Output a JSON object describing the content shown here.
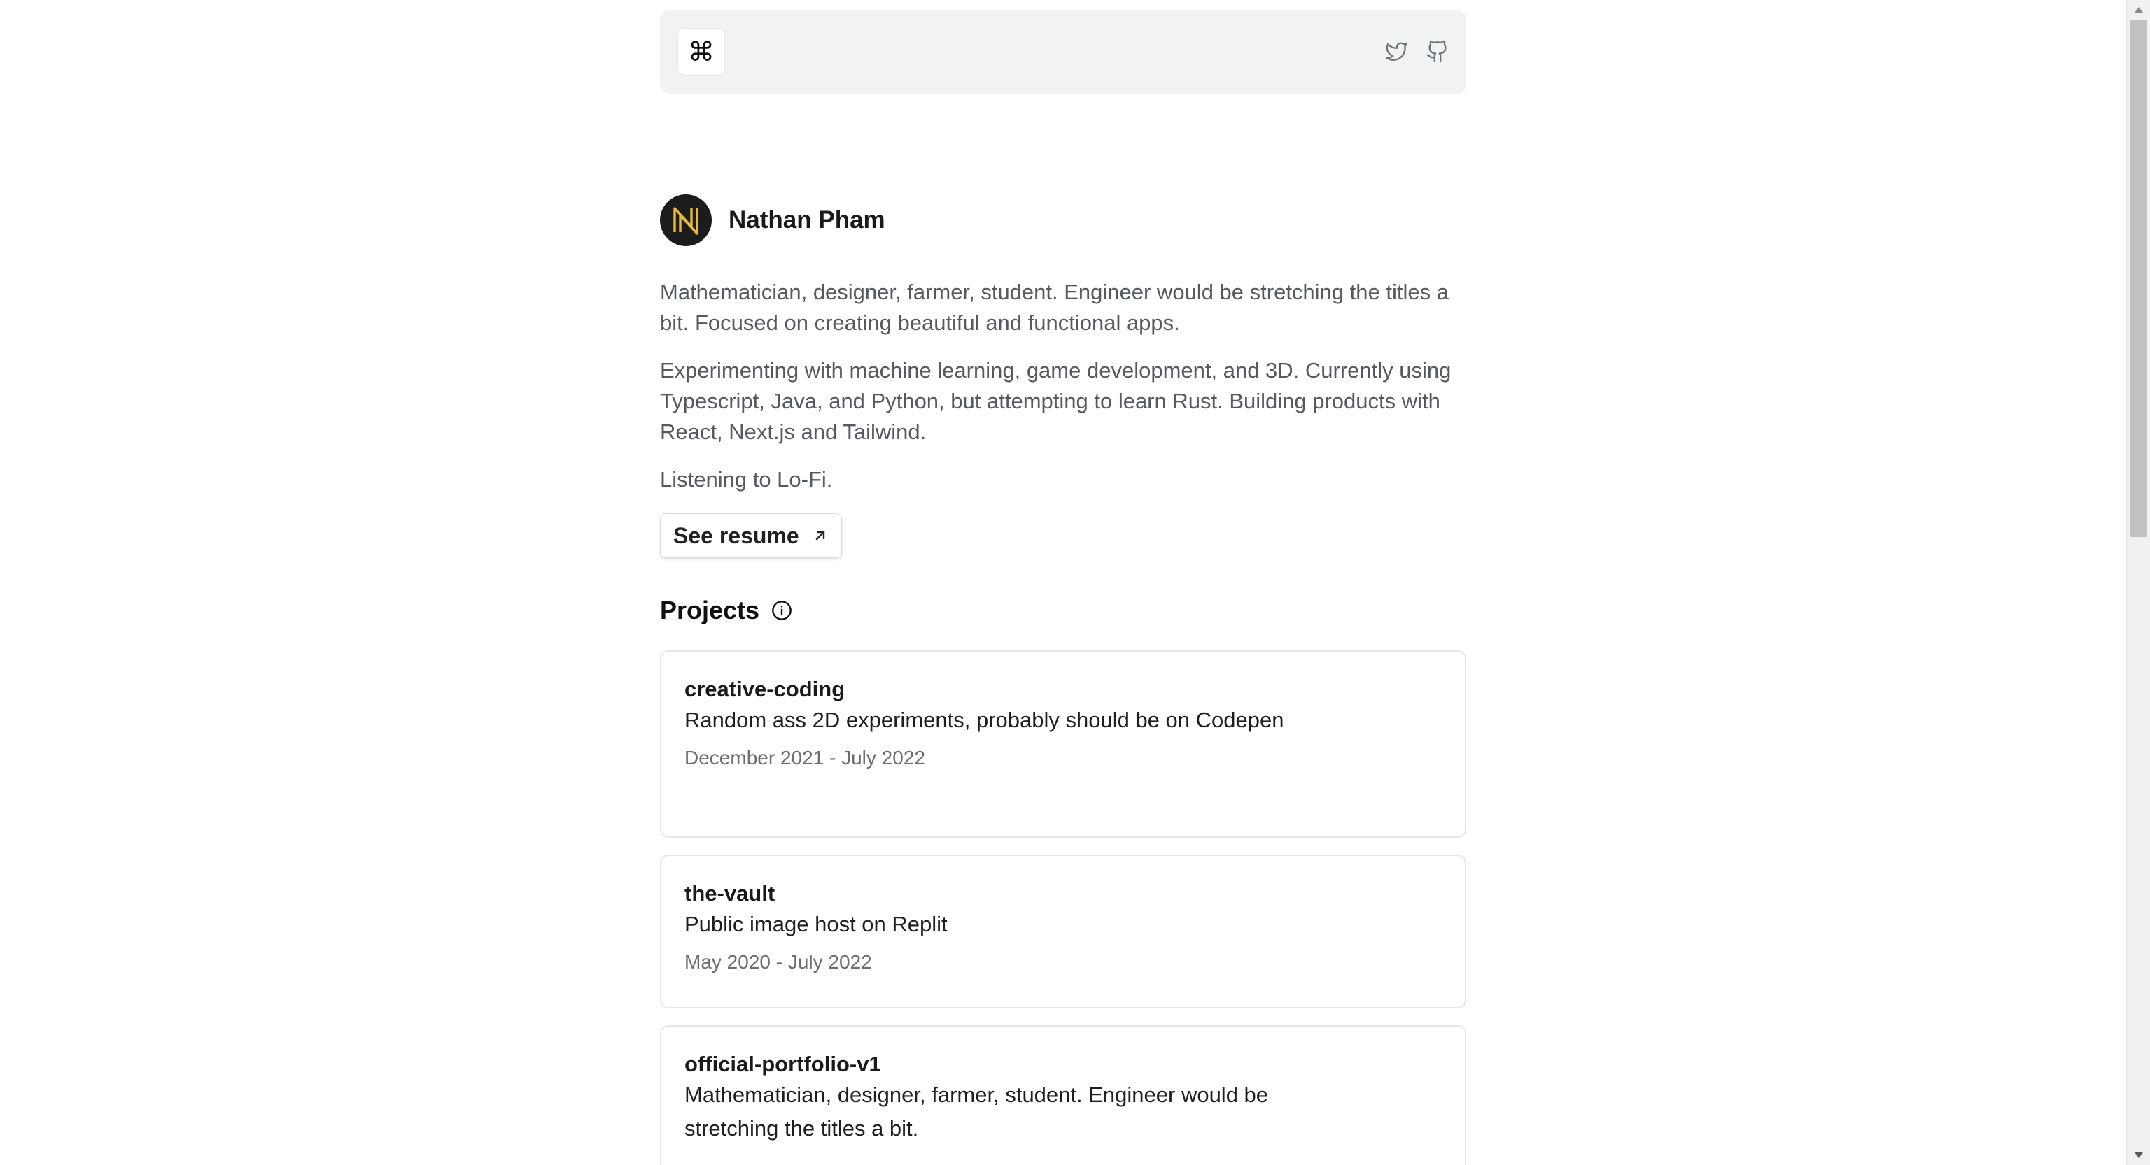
{
  "header": {
    "command_glyph": "⌘",
    "icons": [
      "twitter-icon",
      "github-icon"
    ]
  },
  "profile": {
    "name": "Nathan Pham",
    "avatar_letter": "N",
    "avatar_color": "#e8b93a"
  },
  "bio": {
    "p1": "Mathematician, designer, farmer, student. Engineer would be stretching the titles a bit. Focused on creating beautiful and functional apps.",
    "p2": "Experimenting with machine learning, game development, and 3D. Currently using Typescript, Java, and Python, but attempting to learn Rust. Building products with React, Next.js and Tailwind.",
    "p3": "Listening to Lo-Fi."
  },
  "resume": {
    "label": "See resume"
  },
  "projects": {
    "heading": "Projects",
    "items": [
      {
        "title": "creative-coding",
        "description": "Random ass 2D experiments, probably should be on Codepen",
        "dates": "December 2021 - July 2022"
      },
      {
        "title": "the-vault",
        "description": "Public image host on Replit",
        "dates": "May 2020 - July 2022"
      },
      {
        "title": "official-portfolio-v1",
        "description": "Mathematician, designer, farmer, student. Engineer would be stretching the titles a bit.",
        "dates": ""
      }
    ]
  }
}
